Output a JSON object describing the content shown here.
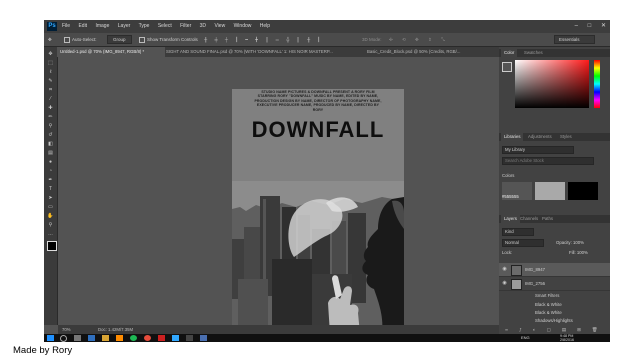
{
  "app": {
    "logo": "Ps",
    "menu": [
      "File",
      "Edit",
      "Image",
      "Layer",
      "Type",
      "Select",
      "Filter",
      "3D",
      "View",
      "Window",
      "Help"
    ],
    "window_controls": [
      "–",
      "□",
      "✕"
    ]
  },
  "options_bar": {
    "auto_select_label": "Auto-Select:",
    "auto_select_value": "Group",
    "transform_label": "Show Transform Controls",
    "mode_label": "3D Mode:",
    "workspace": "Essentials"
  },
  "doc_tabs": [
    "Untitled-1.psd @ 70% (IMG_8947, RGB/8) *",
    "SIGHT AND SOUND FINAL.psd @ 70% (WITH 'DOWNFALL' 1: HIS NOIR MASTERP...",
    "Basic_Credit_Block.psd @ 50% (Credits, RGB/..."
  ],
  "poster": {
    "credits": "STUDIO NAME PICTURES & DOWNFALL PRESENT A RORY FILM STARRING RORY \"DOWNFALL\" MUSIC BY NAME, EDITED BY NAME, PRODUCTION DESIGN BY NAME, DIRECTOR OF PHOTOGRAPHY NAME, EXECUTIVE PRODUCER NAME, PRODUCED BY NAME, DIRECTED BY RORY",
    "title": "DOWNFALL",
    "colors": {
      "sky": "#8a8a8a",
      "buildings": "#3c3c3c",
      "smoke": "#d4d4d4"
    }
  },
  "status": {
    "zoom": "70%",
    "doc": "Doc: 1.42M/7.35M"
  },
  "panels": {
    "color_tabs": [
      "Color",
      "Swatches"
    ],
    "library_tabs": [
      "Libraries",
      "Adjustments",
      "Styles"
    ],
    "library_select": "My Library",
    "library_search": "Search Adobe Stock",
    "colors_label": "Colors",
    "swatch_hex": "#555555",
    "layers_tabs": [
      "Layers",
      "Channels",
      "Paths"
    ],
    "kind_label": "Kind",
    "blend_mode": "Normal",
    "opacity_label": "Opacity: 100%",
    "lock_label": "Lock:",
    "fill_label": "Fill: 100%",
    "layers": [
      {
        "name": "IMG_8947"
      },
      {
        "name": "IMG_2756"
      }
    ],
    "smart_filters_label": "Smart Filters",
    "filters": [
      "Black & White",
      "Black & White",
      "Shadows/Highlights"
    ],
    "accent_color": "#31a8ff"
  },
  "taskbar": {
    "language": "ENG",
    "time": "9:48 PM",
    "date": "2/8/2016"
  },
  "caption": "Made by Rory"
}
